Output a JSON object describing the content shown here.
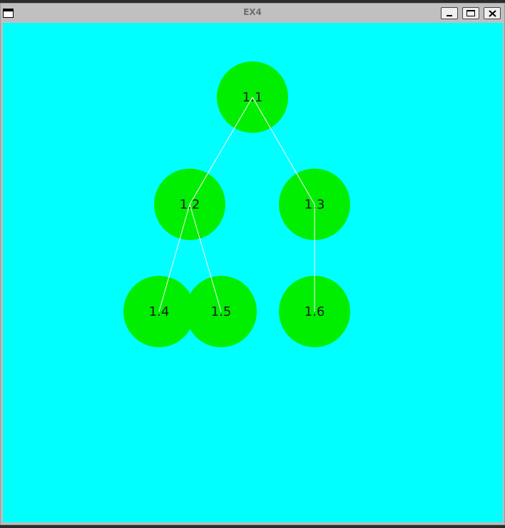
{
  "window": {
    "title": "EX4"
  },
  "colors": {
    "canvas_background": "#00ffff",
    "node_fill": "#00ee00",
    "edge_stroke": "#ffffff",
    "label_color": "#1a1a1a"
  },
  "icons": {
    "system_menu": "window-menu-icon",
    "minimize": "minimize-icon",
    "maximize": "maximize-icon",
    "close": "close-icon"
  },
  "tree": {
    "nodes": [
      {
        "id": "1.1",
        "label": "1.1"
      },
      {
        "id": "1.2",
        "label": "1.2"
      },
      {
        "id": "1.3",
        "label": "1.3"
      },
      {
        "id": "1.4",
        "label": "1.4"
      },
      {
        "id": "1.5",
        "label": "1.5"
      },
      {
        "id": "1.6",
        "label": "1.6"
      }
    ],
    "edges": [
      {
        "from": "1.1",
        "to": "1.2"
      },
      {
        "from": "1.1",
        "to": "1.3"
      },
      {
        "from": "1.2",
        "to": "1.4"
      },
      {
        "from": "1.2",
        "to": "1.5"
      },
      {
        "from": "1.3",
        "to": "1.6"
      }
    ]
  }
}
